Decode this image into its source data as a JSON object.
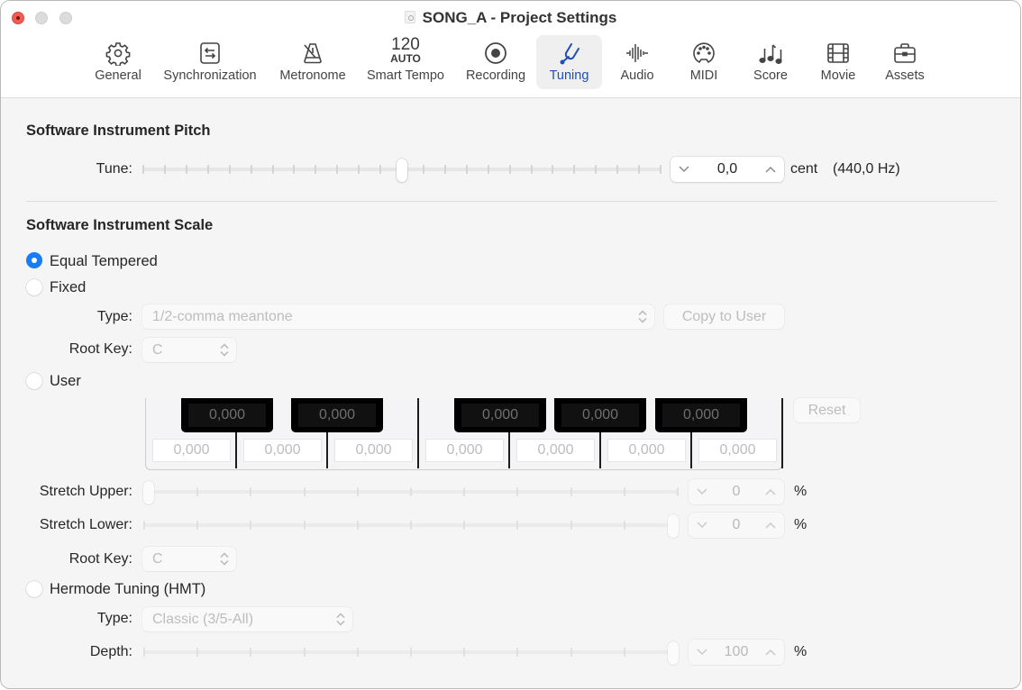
{
  "window": {
    "title": "SONG_A - Project Settings",
    "title_icon": "document-icon",
    "controls": [
      "close",
      "minimize",
      "zoom"
    ]
  },
  "toolbar": {
    "active_tab": "Tuning",
    "accent_color": "#1f4fb5",
    "tabs": [
      {
        "label": "General",
        "icon": "gear-icon"
      },
      {
        "label": "Synchronization",
        "icon": "sync-arrows-icon"
      },
      {
        "label": "Metronome",
        "icon": "metronome-icon"
      },
      {
        "label": "Smart Tempo",
        "icon": "tempo-icon",
        "icon_text": "120",
        "icon_subtext": "AUTO"
      },
      {
        "label": "Recording",
        "icon": "record-icon"
      },
      {
        "label": "Tuning",
        "icon": "tuning-fork-icon"
      },
      {
        "label": "Audio",
        "icon": "waveform-icon"
      },
      {
        "label": "MIDI",
        "icon": "midi-port-icon"
      },
      {
        "label": "Score",
        "icon": "music-notes-icon"
      },
      {
        "label": "Movie",
        "icon": "film-icon"
      },
      {
        "label": "Assets",
        "icon": "briefcase-icon"
      }
    ]
  },
  "pitch": {
    "heading": "Software Instrument Pitch",
    "tune_label": "Tune:",
    "tune_slider_fraction": 0.5,
    "tune_value": "0,0",
    "tune_unit": "cent",
    "tune_hz": "(440,0 Hz)"
  },
  "scale": {
    "heading": "Software Instrument Scale",
    "selected": "Equal Tempered",
    "options": {
      "equal": "Equal Tempered",
      "fixed": "Fixed",
      "user": "User",
      "hermode": "Hermode Tuning (HMT)"
    },
    "fixed": {
      "type_label": "Type:",
      "type_value": "1/2-comma meantone",
      "copy_button": "Copy to User",
      "root_label": "Root Key:",
      "root_value": "C"
    },
    "user": {
      "black_keys": [
        "0,000",
        "0,000",
        "0,000",
        "0,000",
        "0,000"
      ],
      "white_keys": [
        "0,000",
        "0,000",
        "0,000",
        "0,000",
        "0,000",
        "0,000",
        "0,000"
      ],
      "reset_button": "Reset",
      "stretch_upper_label": "Stretch Upper:",
      "stretch_upper_value": "0",
      "stretch_upper_fraction": 0.0,
      "stretch_lower_label": "Stretch Lower:",
      "stretch_lower_value": "0",
      "stretch_lower_fraction": 1.0,
      "percent": "%",
      "root_label": "Root Key:",
      "root_value": "C"
    },
    "hermode": {
      "type_label": "Type:",
      "type_value": "Classic (3/5-All)",
      "depth_label": "Depth:",
      "depth_value": "100",
      "depth_fraction": 1.0,
      "percent": "%"
    }
  }
}
